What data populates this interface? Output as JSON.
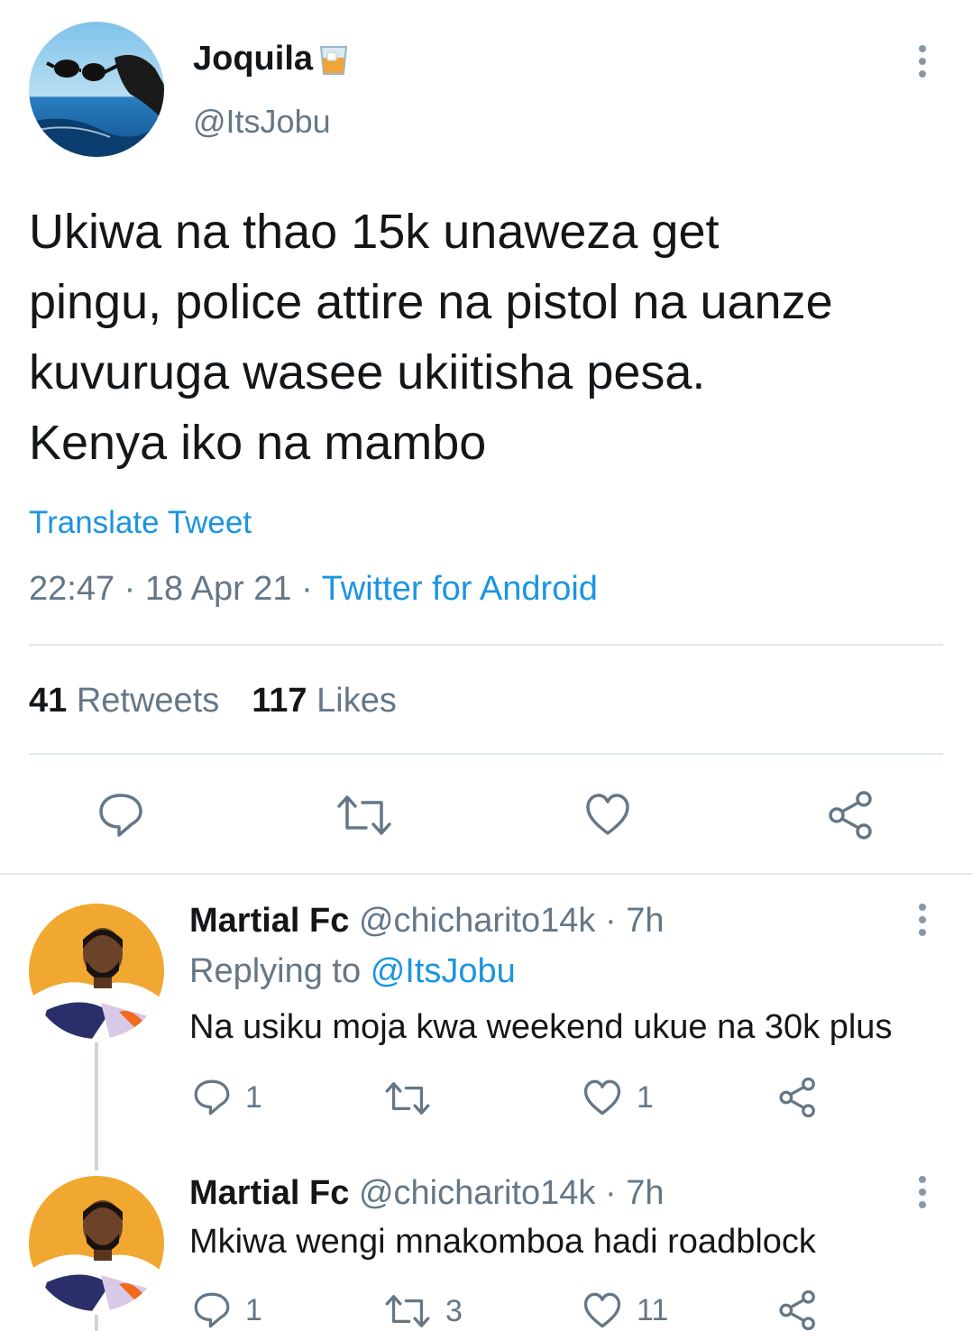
{
  "tweet": {
    "author_name": "Joquila",
    "author_emoji": "🥃",
    "author_handle": "@ItsJobu",
    "lines": [
      "Ukiwa na thao 15k unaweza get",
      "pingu, police attire na pistol na uanze",
      "kuvuruga wasee ukiitisha pesa.",
      "Kenya iko na mambo"
    ],
    "translate": "Translate Tweet",
    "time": "22:47",
    "date": "18 Apr 21",
    "separator": "·",
    "client": "Twitter for Android",
    "retweets_count": "41",
    "retweets_label": "Retweets",
    "likes_count": "117",
    "likes_label": "Likes"
  },
  "replies": [
    {
      "name": "Martial Fc",
      "handle": "@chicharito14k",
      "age": "· 7h",
      "replying_to_label": "Replying to",
      "replying_to_handle": "@ItsJobu",
      "text": "Na usiku moja kwa weekend ukue na 30k plus",
      "reply_count": "1",
      "retweet_count": "",
      "like_count": "1"
    },
    {
      "name": "Martial Fc",
      "handle": "@chicharito14k",
      "age": "· 7h",
      "text": "Mkiwa wengi mnakomboa hadi roadblock",
      "reply_count": "1",
      "retweet_count": "3",
      "like_count": "11"
    }
  ],
  "icons": {
    "reply": "comment-bubble-icon",
    "retweet": "retweet-arrows-icon",
    "like": "heart-icon",
    "share": "share-nodes-icon",
    "more": "vertical-ellipsis-icon"
  },
  "colors": {
    "link": "#1b95e0",
    "secondary": "#657786",
    "icon": "#657786",
    "divider": "#e1e8ed"
  }
}
